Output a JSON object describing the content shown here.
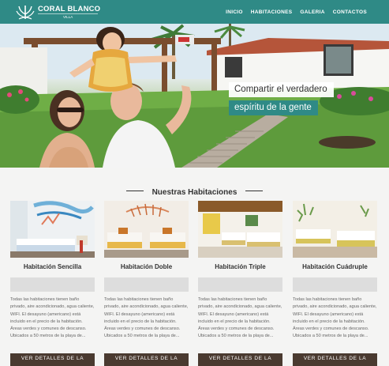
{
  "header": {
    "brand": "CORAL BLANCO",
    "brand_sub": "VILLA",
    "nav": [
      "INICIO",
      "HABITACIONES",
      "GALERIA",
      "CONTACTOS"
    ]
  },
  "hero": {
    "caption_line1": "Compartir el verdadero",
    "caption_line2": "espíritu de la gente"
  },
  "section": {
    "title": "Nuestras Habitaciones"
  },
  "rooms": [
    {
      "name": "Habitación Sencilla",
      "description": "Todas las habitaciones tienen baño privado, aire acondicionado, agua caliente, WIFI. El desayuno (americano) está incluido en el precio de la habitación. Áreas verdes y comunes de descanso. Ubicados a 50 metros de la playa de...",
      "button": "VER DETALLES DE LA"
    },
    {
      "name": "Habitación Doble",
      "description": "Todas las habitaciones tienen baño privado, aire acondicionado, agua caliente, WIFI. El desayuno (americano) está incluido en el precio de la habitación. Áreas verdes y comunes de descanso. Ubicados a 50 metros de la playa de...",
      "button": "VER DETALLES DE LA"
    },
    {
      "name": "Habitación Triple",
      "description": "Todas las habitaciones tienen baño privado, aire acondicionado, agua caliente, WIFI. El desayuno (americano) está incluido en el precio de la habitación. Áreas verdes y comunes de descanso. Ubicados a 50 metros de la playa de...",
      "button": "VER DETALLES DE LA"
    },
    {
      "name": "Habitación Cuádruple",
      "description": "Todas las habitaciones tienen baño privado, aire acondicionado, agua caliente, WIFI. El desayuno (americano) está incluido en el precio de la habitación. Áreas verdes y comunes de descanso. Ubicados a 50 metros de la playa de...",
      "button": "VER DETALLES DE LA"
    }
  ],
  "colors": {
    "brand": "#2f8a86",
    "button": "#4a3a30",
    "background": "#f4f4f3"
  }
}
